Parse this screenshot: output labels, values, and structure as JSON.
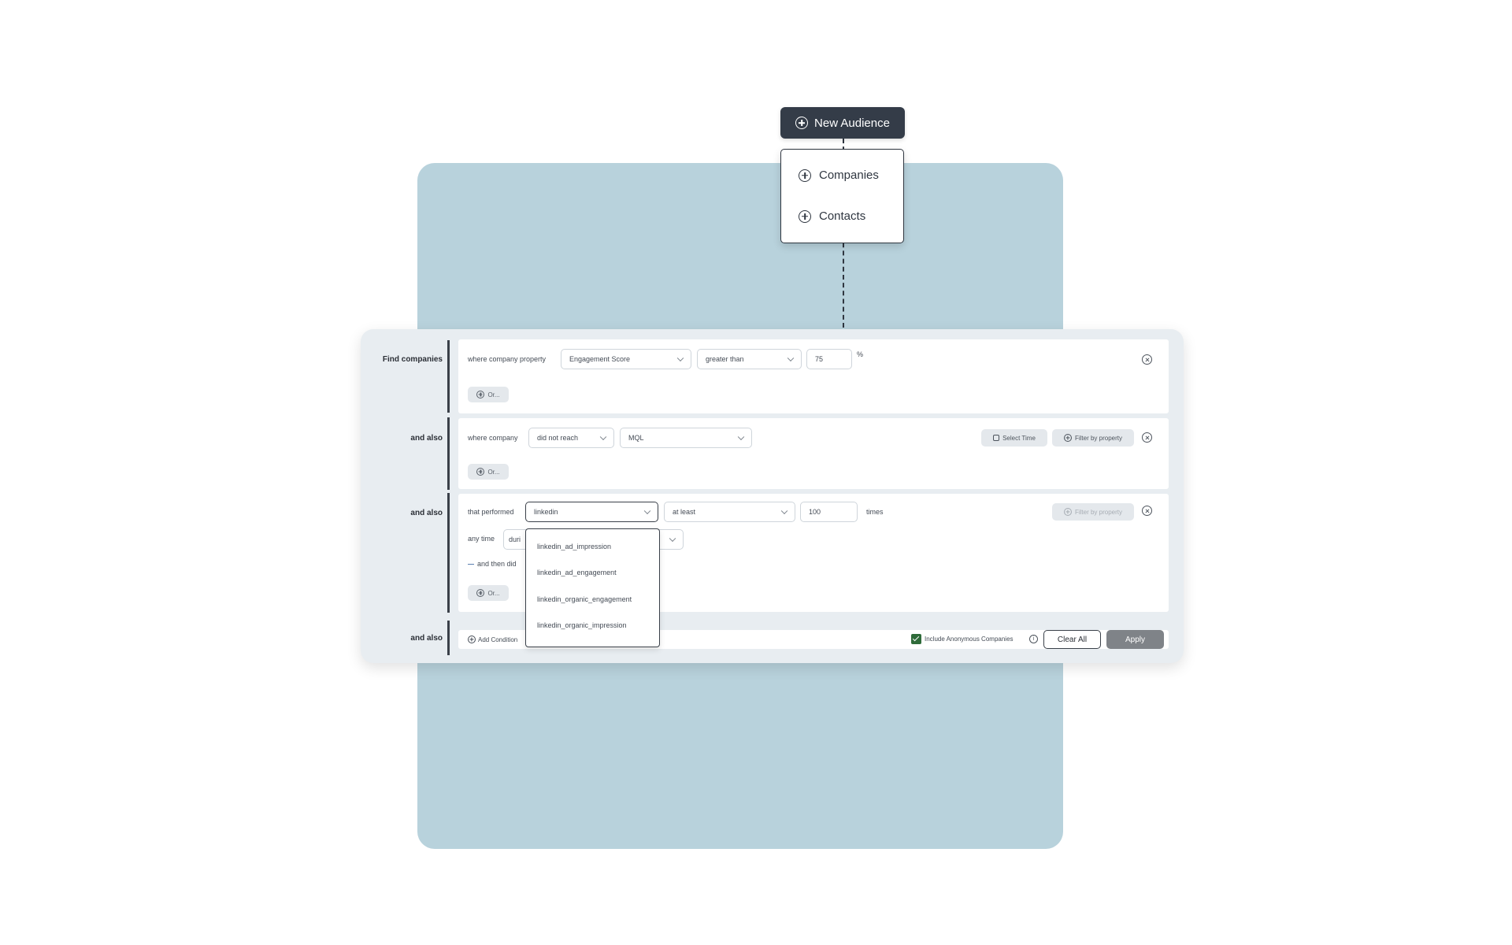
{
  "new_audience": {
    "button_label": "New Audience",
    "menu_items": [
      "Companies",
      "Contacts"
    ]
  },
  "rows": {
    "find_companies_label": "Find companies",
    "and_also_label": "and also",
    "row1": {
      "prefix": "where company property",
      "property": "Engagement Score",
      "operator": "greater than",
      "value": "75",
      "unit": "%",
      "or_label": "Or..."
    },
    "row2": {
      "prefix": "where company",
      "operator": "did not reach",
      "stage": "MQL",
      "select_time": "Select Time",
      "filter_by_property": "Filter by property",
      "or_label": "Or..."
    },
    "row3": {
      "prefix": "that performed",
      "event": "linkedin",
      "qualifier": "at least",
      "count": "100",
      "times": "times",
      "filter_by_property": "Filter by property",
      "any_time": "any time",
      "during_partial": "duri",
      "and_then_partial": "and then did",
      "or_label": "Or..."
    },
    "row4": {
      "add_condition": "Add Condition"
    }
  },
  "event_dropdown": {
    "options": [
      "linkedin_ad_impression",
      "linkedin_ad_engagement",
      "linkedin_organic_engagement",
      "linkedin_organic_impression"
    ]
  },
  "footer": {
    "include_anonymous": "Include Anonymous Companies",
    "info": "i",
    "clear_all": "Clear All",
    "apply": "Apply"
  },
  "colors": {
    "background_card": "#b8d2dc",
    "dark_button": "#343c48",
    "checkbox": "#2f6b3a",
    "apply_button": "#7f8388"
  }
}
